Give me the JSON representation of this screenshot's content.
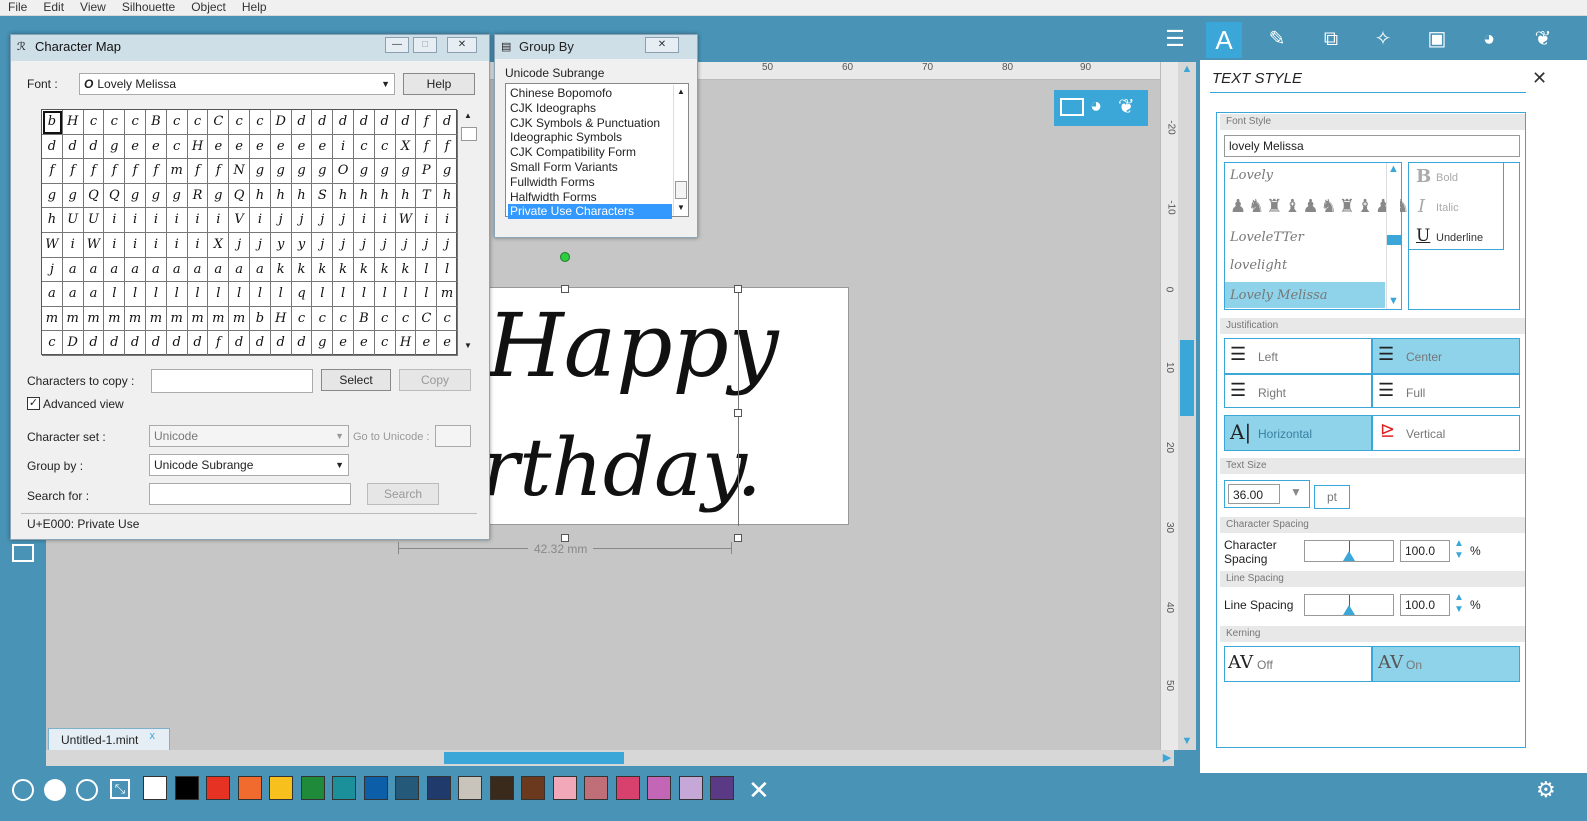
{
  "menu": [
    "File",
    "Edit",
    "View",
    "Silhouette",
    "Object",
    "Help"
  ],
  "canvas": {
    "ruler_top_labels": [
      "50",
      "60",
      "70",
      "80",
      "90"
    ],
    "ruler_right_labels": [
      "-20",
      "-10",
      "0",
      "10",
      "20",
      "30",
      "40",
      "50"
    ],
    "text_line1": "Happy",
    "text_line2": "rthday.",
    "dimension": "42.32 mm",
    "tab_label": "Untitled-1.mint",
    "tab_close": "x"
  },
  "bottom_swatches": [
    "#ffffff",
    "#000000",
    "#e63222",
    "#f26b2e",
    "#f7c01d",
    "#1f8b3a",
    "#1b8f9a",
    "#0c5ea8",
    "#25597a",
    "#1f3a6b",
    "#c8c4bc",
    "#3a2a1c",
    "#6b3a1e",
    "#f2a8b8",
    "#c06e78",
    "#d8406e",
    "#c466b6",
    "#c6a8d8",
    "#5a3a84"
  ],
  "right_panel": {
    "title": "TEXT STYLE",
    "font_style_head": "Font Style",
    "font_input": "lovely Melissa",
    "font_list": [
      "Lovely",
      "",
      "LoveleTTer",
      "lovelight",
      "Lovely Melissa"
    ],
    "style_bold": "Bold",
    "style_italic": "Italic",
    "style_underline": "Underline",
    "justification_head": "Justification",
    "just_left": "Left",
    "just_center": "Center",
    "just_right": "Right",
    "just_full": "Full",
    "orient_horizontal": "Horizontal",
    "orient_vertical": "Vertical",
    "text_size_head": "Text Size",
    "text_size": "36.00",
    "text_size_unit": "pt",
    "char_spacing_head": "Character Spacing",
    "char_spacing_label": "Character Spacing",
    "char_spacing_value": "100.0",
    "line_spacing_head": "Line Spacing",
    "line_spacing_label": "Line Spacing",
    "line_spacing_value": "100.0",
    "percent": "%",
    "kerning_head": "Kerning",
    "kern_off": "Off",
    "kern_on": "On"
  },
  "charmap": {
    "title": "Character Map",
    "font_label": "Font :",
    "font_value": "Lovely Melissa",
    "help": "Help",
    "chars_to_copy_label": "Characters to copy :",
    "select": "Select",
    "copy": "Copy",
    "advanced_view": "Advanced view",
    "character_set_label": "Character set :",
    "character_set_value": "Unicode",
    "goto_unicode_label": "Go to Unicode :",
    "group_by_label": "Group by :",
    "group_by_value": "Unicode Subrange",
    "search_for_label": "Search for :",
    "search_btn": "Search",
    "status": "U+E000: Private Use",
    "glyphs": "bHcccBccCccDddddddfddddgeecHeeeeeeiccXffffffffmffNggggOgggPgggQQgggRgQhhhShhhhThhUUiiiiiiVijjjjiiWiiWiWiiiiiXjjyyjjjjjjjjaaaaaaaaaakkkkkkkllaaalllllllllqllllllmmmmmmmmmmm"
  },
  "groupby": {
    "title": "Group By",
    "header": "Unicode Subrange",
    "items": [
      "Chinese Bopomofo",
      "CJK Ideographs",
      "CJK Symbols & Punctuation",
      "Ideographic Symbols",
      "CJK Compatibility Form",
      "Small Form Variants",
      "Fullwidth Forms",
      "Halfwidth Forms",
      "Private Use Characters"
    ],
    "selected_index": 8
  }
}
